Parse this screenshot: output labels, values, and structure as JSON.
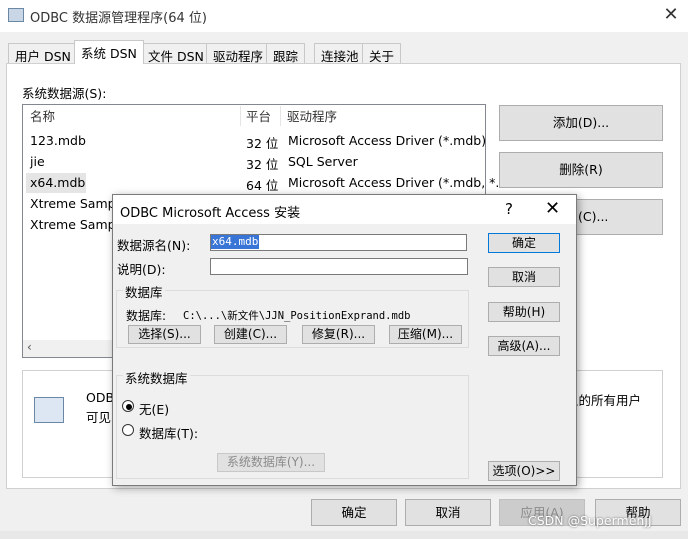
{
  "window": {
    "title": "ODBC 数据源管理程序(64 位)",
    "close": "✕"
  },
  "tabs": [
    {
      "label": "用户 DSN"
    },
    {
      "label": "系统 DSN"
    },
    {
      "label": "文件 DSN"
    },
    {
      "label": "驱动程序"
    },
    {
      "label": "跟踪"
    },
    {
      "label": "连接池"
    },
    {
      "label": "关于"
    }
  ],
  "system_dsn": {
    "section_label": "系统数据源(S):",
    "columns": [
      "名称",
      "平台",
      "驱动程序"
    ],
    "rows": [
      {
        "name": "123.mdb",
        "platform": "32 位",
        "driver": "Microsoft Access Driver (*.mdb)"
      },
      {
        "name": "jie",
        "platform": "32 位",
        "driver": "SQL Server"
      },
      {
        "name": "x64.mdb",
        "platform": "64 位",
        "driver": "Microsoft Access Driver (*.mdb, *."
      },
      {
        "name": "Xtreme Sampl",
        "platform": "",
        "driver": ""
      },
      {
        "name": "Xtreme Sampl",
        "platform": "",
        "driver": ""
      }
    ],
    "buttons": {
      "add": "添加(D)...",
      "remove": "删除(R)",
      "configure": "(C)..."
    },
    "info": {
      "text1": "ODB",
      "text2": "可见",
      "text_right": "上的所有用户"
    }
  },
  "footer": {
    "ok": "确定",
    "cancel": "取消",
    "apply": "应用(A)",
    "help": "帮助"
  },
  "watermark": "CSDN @SupermenJJ",
  "dialog": {
    "title": "ODBC Microsoft Access 安装",
    "help_glyph": "?",
    "close_glyph": "✕",
    "dsn_label": "数据源名(N):",
    "dsn_value": "x64.mdb",
    "desc_label": "说明(D):",
    "desc_value": "",
    "database_group": "数据库",
    "database_label": "数据库:",
    "database_path": "C:\\...\\新文件\\JJN_PositionExprand.mdb",
    "db_buttons": {
      "select": "选择(S)...",
      "create": "创建(C)...",
      "repair": "修复(R)...",
      "compact": "压缩(M)..."
    },
    "sysdb_group": "系统数据库",
    "radio_none": "无(E)",
    "radio_db": "数据库(T):",
    "sysdb_button": "系统数据库(Y)...",
    "buttons": {
      "ok": "确定",
      "cancel": "取消",
      "help": "帮助(H)",
      "advanced": "高级(A)...",
      "options": "选项(O)>>"
    }
  }
}
